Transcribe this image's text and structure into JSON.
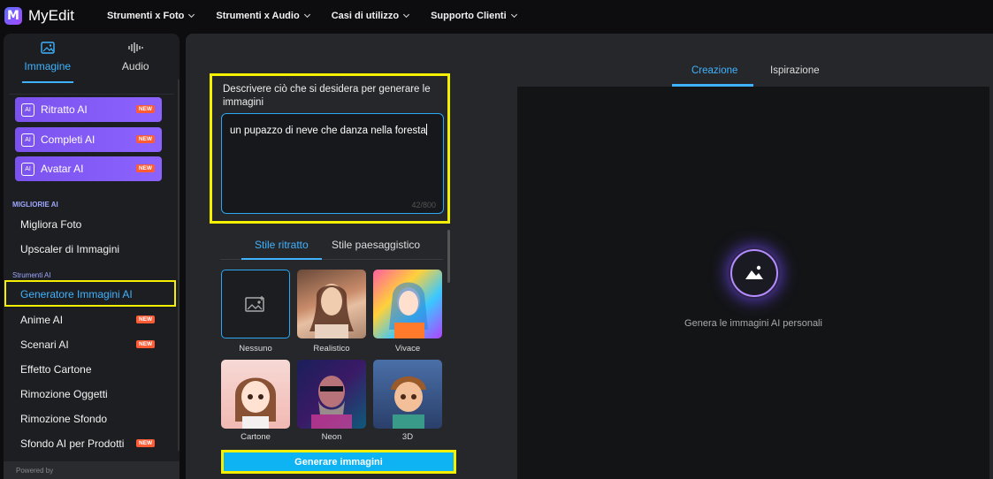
{
  "app": {
    "name": "MyEdit",
    "logo_letter": "M"
  },
  "nav": [
    {
      "label": "Strumenti x Foto"
    },
    {
      "label": "Strumenti x Audio"
    },
    {
      "label": "Casi di utilizzo"
    },
    {
      "label": "Supporto Clienti"
    }
  ],
  "sidebar": {
    "tabs": [
      {
        "label": "Immagine",
        "icon": "image-icon",
        "active": true
      },
      {
        "label": "Audio",
        "icon": "waveform-icon",
        "active": false
      }
    ],
    "ai_buttons": [
      {
        "label": "Ritratto AI",
        "badge": "NEW",
        "icon": "ai-sparkle-icon"
      },
      {
        "label": "Completi AI",
        "badge": "NEW",
        "icon": "ai-sparkle-icon"
      },
      {
        "label": "Avatar AI",
        "badge": "NEW",
        "icon": "ai-sparkle-icon"
      }
    ],
    "section_best": "MIGLIORIE AI",
    "best_items": [
      {
        "label": "Migliora Foto"
      },
      {
        "label": "Upscaler di Immagini"
      }
    ],
    "section_tools": "Strumenti AI",
    "tool_items": [
      {
        "label": "Generatore Immagini AI",
        "selected": true
      },
      {
        "label": "Anime AI",
        "badge": "NEW"
      },
      {
        "label": "Scenari AI",
        "badge": "NEW"
      },
      {
        "label": "Effetto Cartone"
      },
      {
        "label": "Rimozione Oggetti"
      },
      {
        "label": "Rimozione Sfondo"
      },
      {
        "label": "Sfondo AI per Prodotti",
        "badge": "NEW"
      }
    ],
    "powered_by": "Powered by"
  },
  "prompt": {
    "label": "Descrivere ciò che si desidera per generare le immagini",
    "value": "un pupazzo di neve che danza nella foresta",
    "counter": "42/800"
  },
  "style_tabs": [
    {
      "label": "Stile ritratto",
      "active": true
    },
    {
      "label": "Stile paesaggistico",
      "active": false
    }
  ],
  "styles": [
    {
      "label": "Nessuno",
      "selected": true
    },
    {
      "label": "Realistico"
    },
    {
      "label": "Vivace"
    },
    {
      "label": "Cartone"
    },
    {
      "label": "Neon"
    },
    {
      "label": "3D"
    }
  ],
  "generate_button": "Generare immagini",
  "right_tabs": [
    {
      "label": "Creazione",
      "active": true
    },
    {
      "label": "Ispirazione",
      "active": false
    }
  ],
  "preview": {
    "text": "Genera le immagini AI personali"
  },
  "colors": {
    "accent": "#3fb3ff",
    "highlight": "#f4f000",
    "ai_button": "#8c63ff",
    "new_badge": "#ff5c35",
    "generate": "#0db3f3"
  }
}
